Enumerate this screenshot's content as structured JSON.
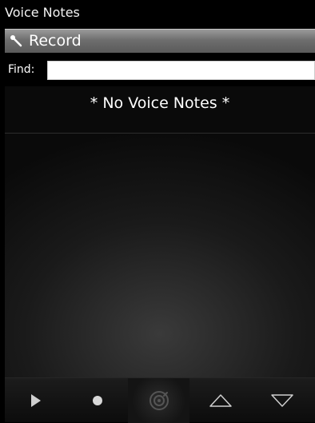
{
  "app": {
    "title": "Voice Notes"
  },
  "record": {
    "label": "Record",
    "icon": "microphone-icon"
  },
  "find": {
    "label": "Find:",
    "value": "",
    "placeholder": ""
  },
  "list": {
    "empty_message": "* No Voice Notes *"
  },
  "toolbar": {
    "buttons": [
      {
        "icon": "play-icon"
      },
      {
        "icon": "record-dot-icon"
      },
      {
        "icon": "voice-note-icon",
        "active": true
      },
      {
        "icon": "up-arrow-icon"
      },
      {
        "icon": "down-arrow-icon"
      }
    ]
  },
  "colors": {
    "background": "#000000",
    "record_bar": "#6e6e6e",
    "text": "#ffffff",
    "toolbar_icon": "#cfcfcf",
    "toolbar_icon_dim": "#555555"
  }
}
